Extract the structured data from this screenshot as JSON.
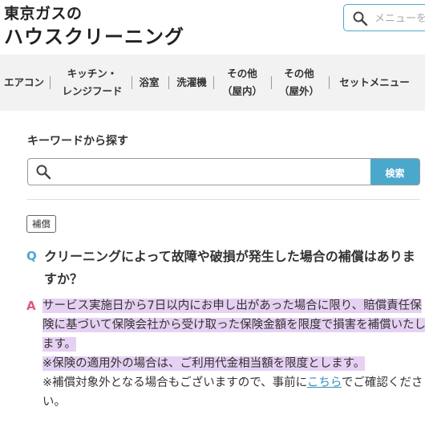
{
  "header": {
    "brand_line1": "東京ガスの",
    "brand_line2": "ハウスクリーニング",
    "search_placeholder": "メニューを"
  },
  "nav": {
    "items": [
      {
        "line1": "エアコン",
        "line2": ""
      },
      {
        "line1": "キッチン・",
        "line2": "レンジフード"
      },
      {
        "line1": "浴室",
        "line2": ""
      },
      {
        "line1": "洗濯機",
        "line2": ""
      },
      {
        "line1": "その他",
        "line2": "（屋内）"
      },
      {
        "line1": "その他",
        "line2": "（屋外）"
      },
      {
        "line1": "セットメニュー",
        "line2": ""
      }
    ]
  },
  "keyword": {
    "title": "キーワードから探す",
    "placeholder": "",
    "button": "検索"
  },
  "faq": {
    "tag": "補償",
    "q_mark": "Q",
    "question": "クリーニングによって故障や破損が発生した場合の補償はありますか？",
    "a_mark": "A",
    "answer_highlight_1": "サービス実施日から7日以内にお申し出があった場合に限り、賠償責任保険に基づいて保険会社から受け取った保険金額を限度で損害を補償いたします。",
    "answer_highlight_2": "※保険の適用外の場合は、ご利用代金相当額を限度とします。",
    "answer_note_before": "※補償対象外となる場合もございますので、事前に",
    "answer_link": "こちら",
    "answer_note_after": "でご確認ください。"
  },
  "colors": {
    "accent": "#4aa8cc",
    "answer_mark": "#e05a7a",
    "highlight": "#e6d1f3",
    "nav_bg": "#f2f2f2"
  }
}
